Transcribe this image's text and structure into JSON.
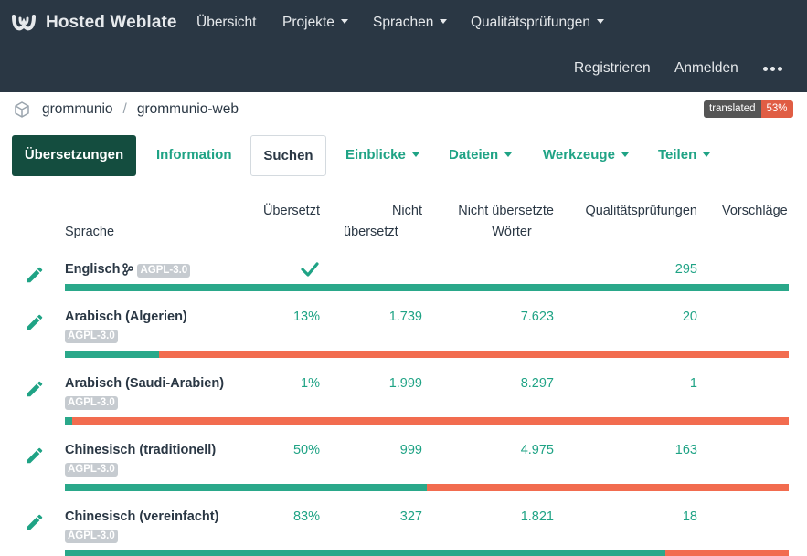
{
  "colors": {
    "navbar": "#2a3744",
    "accent": "#1fa385",
    "dark_green": "#144d3f",
    "bar_done": "#2aa88a",
    "bar_todo": "#f26c4f"
  },
  "navbar": {
    "brand": "Hosted Weblate",
    "items": [
      "Übersicht",
      "Projekte",
      "Sprachen",
      "Qualitätsprüfungen"
    ],
    "register": "Registrieren",
    "login": "Anmelden",
    "more_icon": "ellipsis-icon"
  },
  "breadcrumb": {
    "project": "grommunio",
    "component": "grommunio-web",
    "badge_label": "translated",
    "badge_value": "53%"
  },
  "tabs": {
    "translations": "Übersetzungen",
    "information": "Information",
    "search": "Suchen",
    "insights": "Einblicke",
    "files": "Dateien",
    "tools": "Werkzeuge",
    "share": "Teilen"
  },
  "table": {
    "headers": {
      "language": "Sprache",
      "translated": "Übersetzt",
      "untranslated_1": "Nicht",
      "untranslated_2": "übersetzt",
      "untranslated_words_1": "Nicht übersetzte",
      "untranslated_words_2": "Wörter",
      "checks": "Qualitätsprüfungen",
      "suggestions": "Vorschläge"
    },
    "rows": [
      {
        "name": "Englisch",
        "license": "AGPL-3.0",
        "translated": "",
        "untranslated": "",
        "words": "",
        "checks": "295",
        "progress": 1.0
      },
      {
        "name": "Arabisch (Algerien)",
        "license": "AGPL-3.0",
        "translated": "13%",
        "untranslated": "1.739",
        "words": "7.623",
        "checks": "20",
        "progress": 0.13
      },
      {
        "name": "Arabisch (Saudi-Arabien)",
        "license": "AGPL-3.0",
        "translated": "1%",
        "untranslated": "1.999",
        "words": "8.297",
        "checks": "1",
        "progress": 0.01
      },
      {
        "name": "Chinesisch (traditionell)",
        "license": "AGPL-3.0",
        "translated": "50%",
        "untranslated": "999",
        "words": "4.975",
        "checks": "163",
        "progress": 0.5
      },
      {
        "name": "Chinesisch (vereinfacht)",
        "license": "AGPL-3.0",
        "translated": "83%",
        "untranslated": "327",
        "words": "1.821",
        "checks": "18",
        "progress": 0.83
      }
    ]
  }
}
